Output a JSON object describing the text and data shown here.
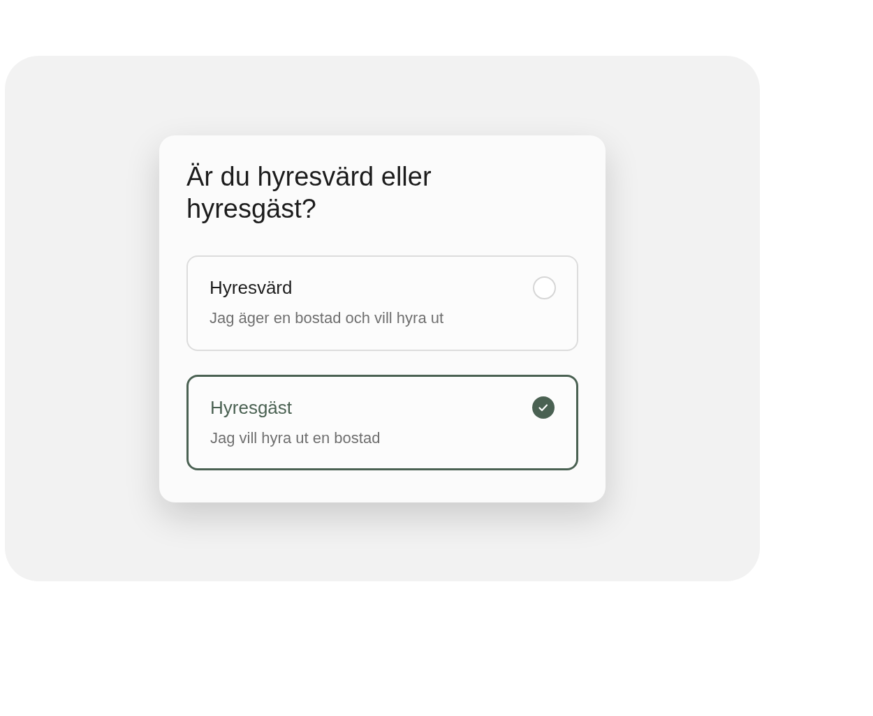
{
  "card": {
    "title": "Är du hyresvärd eller hyresgäst?",
    "options": [
      {
        "title": "Hyresvärd",
        "description": "Jag äger en bostad och vill hyra ut",
        "selected": false
      },
      {
        "title": "Hyresgäst",
        "description": "Jag vill hyra ut en bostad",
        "selected": true
      }
    ]
  }
}
